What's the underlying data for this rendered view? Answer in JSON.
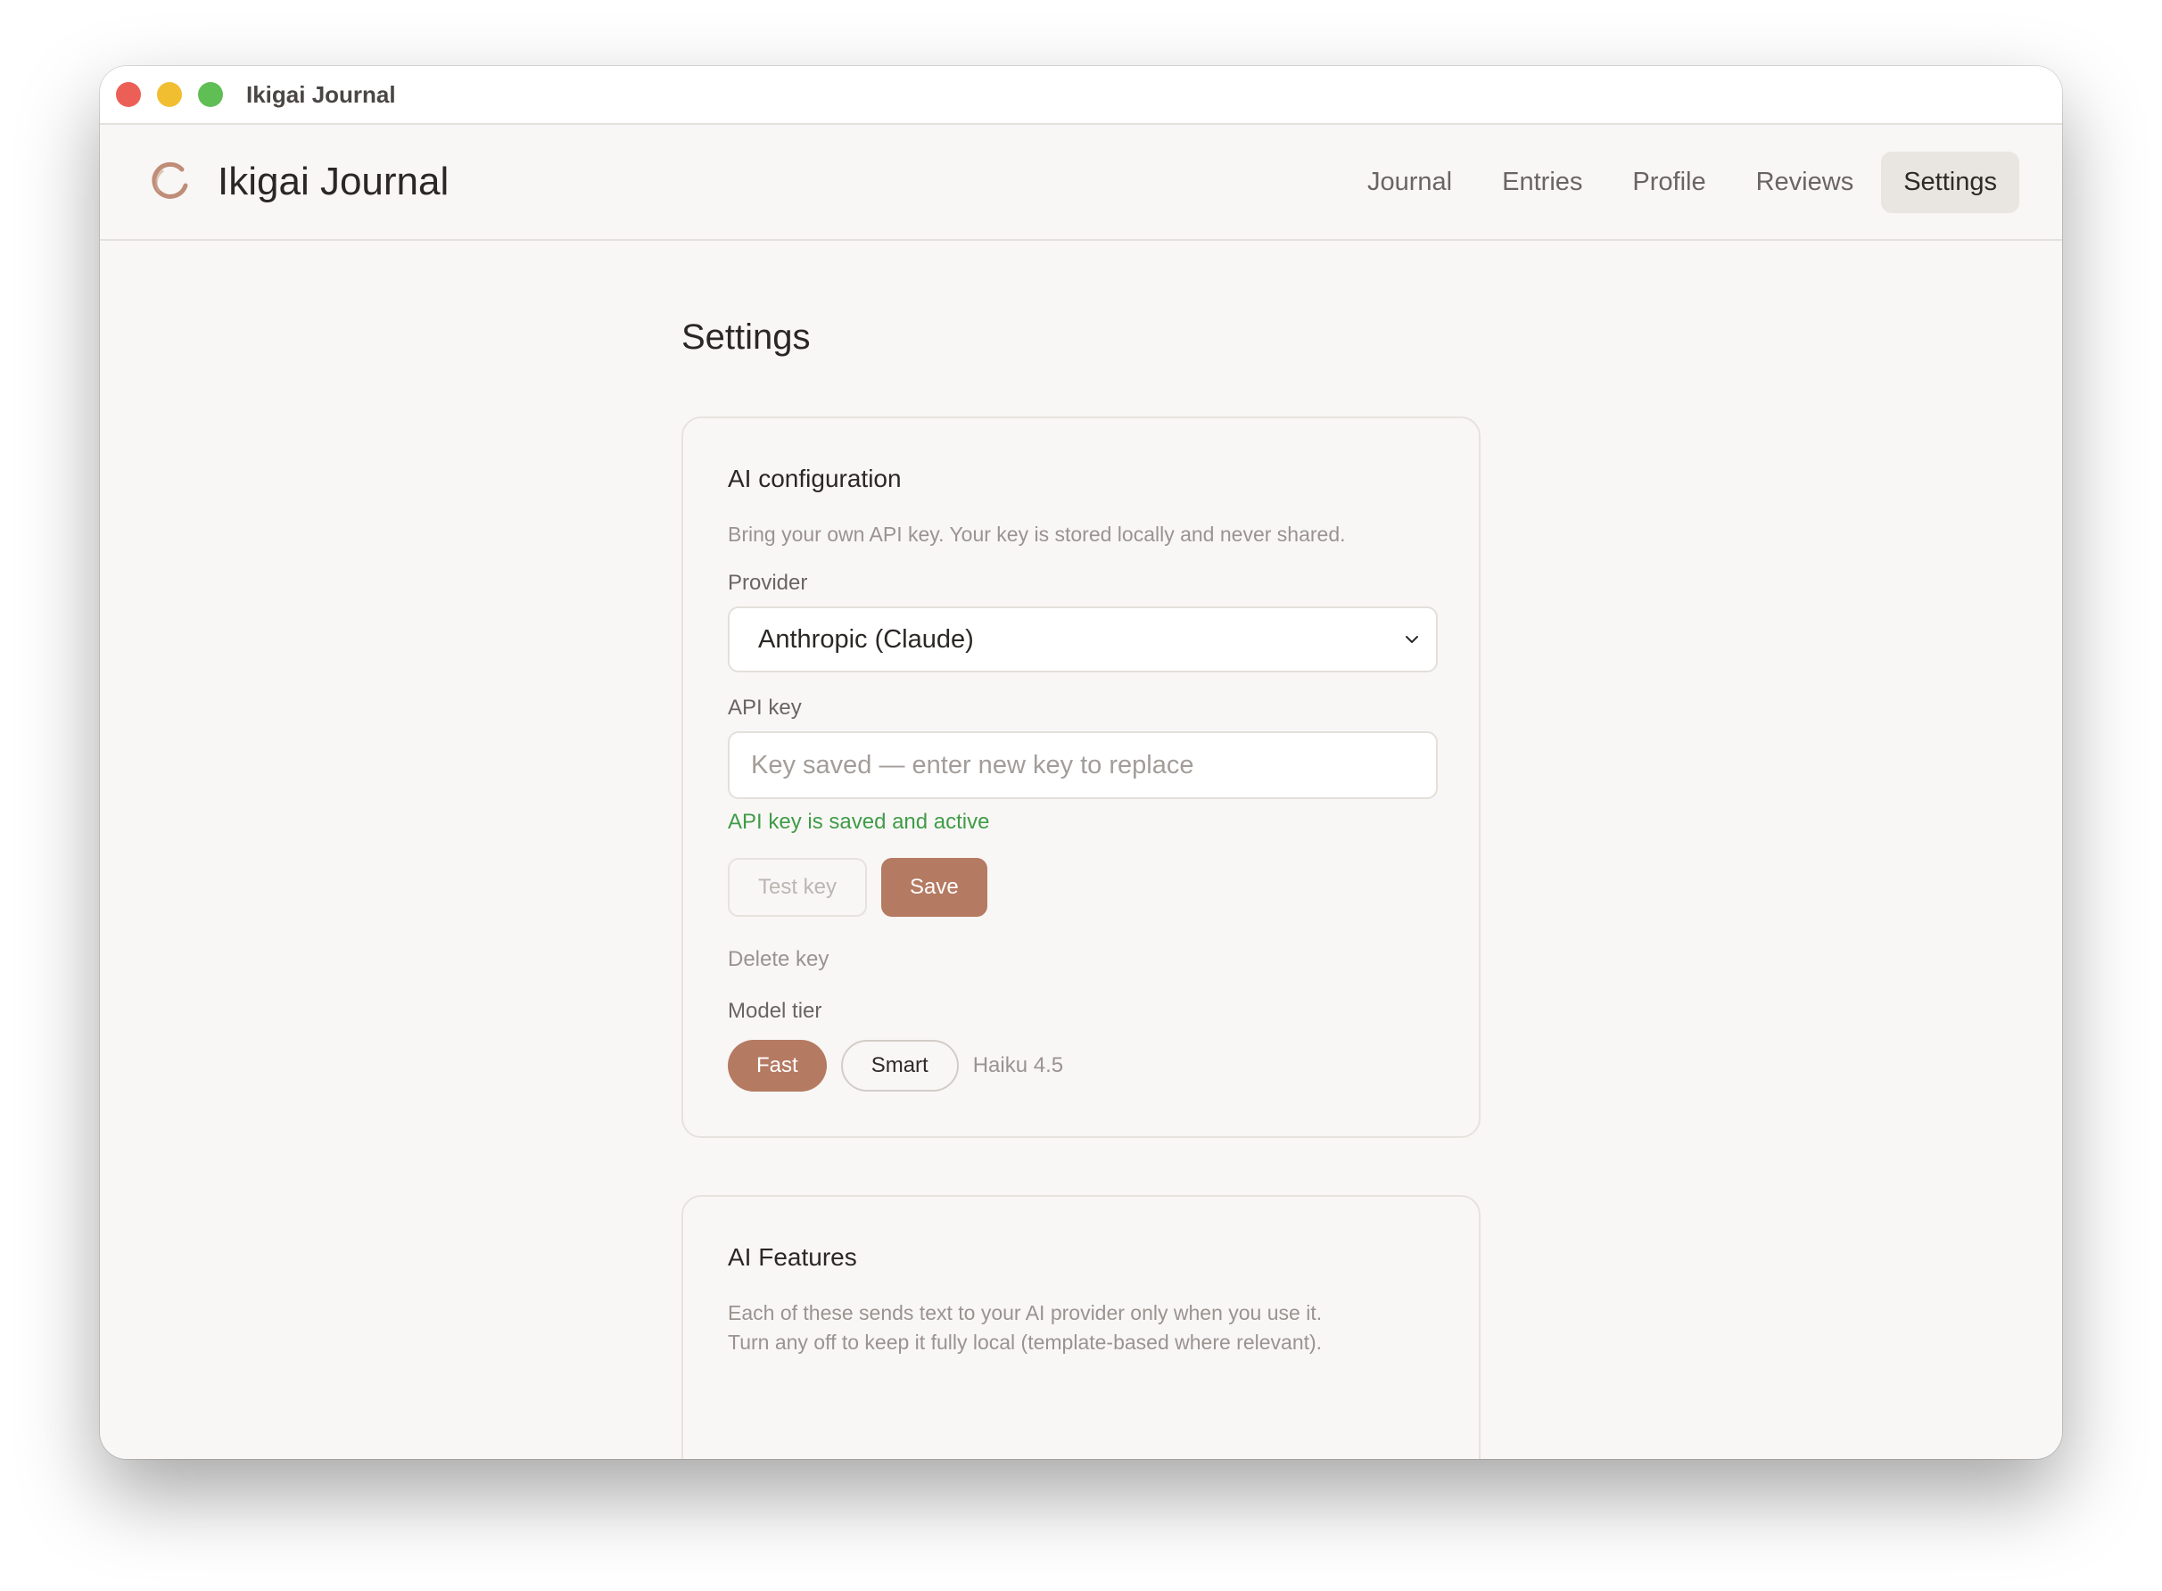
{
  "window": {
    "title": "Ikigai Journal"
  },
  "app": {
    "title": "Ikigai Journal",
    "accent": "#b57a62"
  },
  "nav": {
    "items": [
      {
        "label": "Journal"
      },
      {
        "label": "Entries"
      },
      {
        "label": "Profile"
      },
      {
        "label": "Reviews"
      },
      {
        "label": "Settings",
        "active": true
      }
    ]
  },
  "page": {
    "title": "Settings"
  },
  "ai_config": {
    "title": "AI configuration",
    "description": "Bring your own API key. Your key is stored locally and never shared.",
    "provider_label": "Provider",
    "provider_value": "Anthropic (Claude)",
    "api_key_label": "API key",
    "api_key_placeholder": "Key saved — enter new key to replace",
    "api_key_value": "",
    "status": "API key is saved and active",
    "status_color": "#3f9c48",
    "test_button": "Test key",
    "save_button": "Save",
    "delete_link": "Delete key",
    "model_tier_label": "Model tier",
    "tiers": [
      {
        "label": "Fast",
        "selected": true
      },
      {
        "label": "Smart",
        "selected": false
      }
    ],
    "tier_model": "Haiku 4.5"
  },
  "ai_features": {
    "title": "AI Features",
    "description_line1": "Each of these sends text to your AI provider only when you use it.",
    "description_line2": "Turn any off to keep it fully local (template-based where relevant)."
  }
}
